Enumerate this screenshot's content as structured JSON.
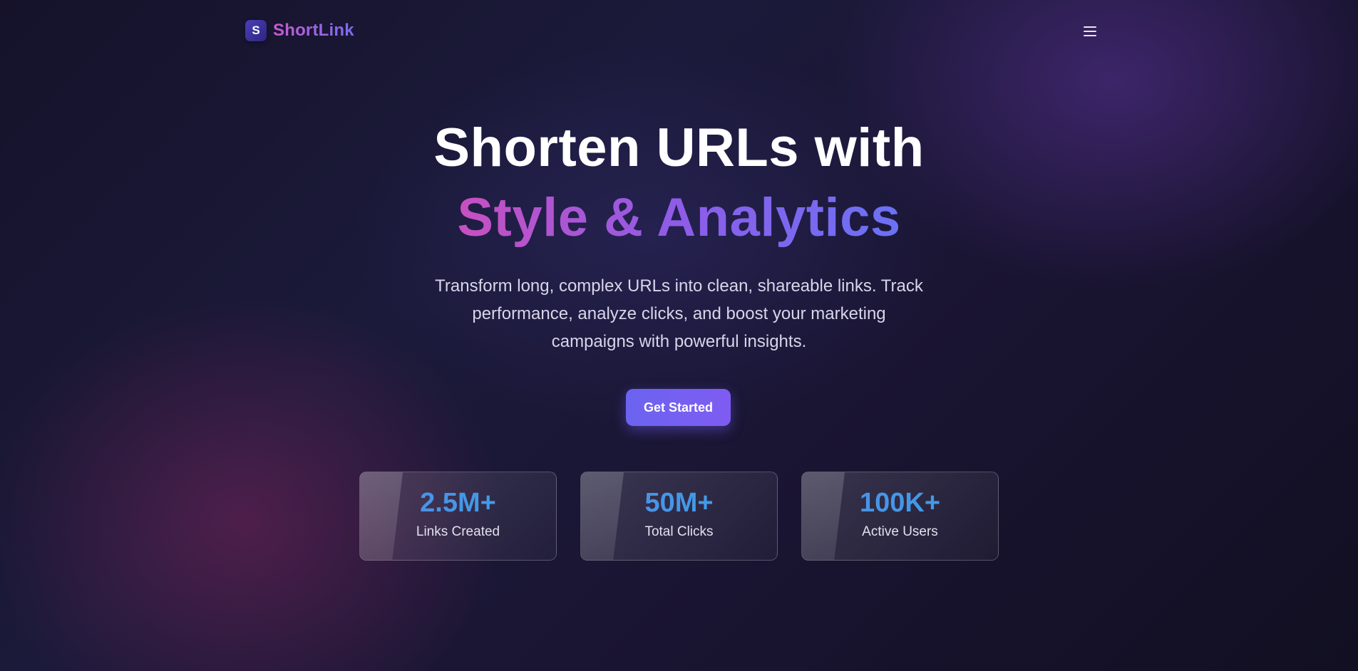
{
  "brand": {
    "logo_letter": "S",
    "name": "ShortLink"
  },
  "header": {
    "menu_icon": "hamburger-menu-icon"
  },
  "hero": {
    "title_line1": "Shorten URLs with",
    "title_line2": "Style & Analytics",
    "description": "Transform long, complex URLs into clean, shareable links. Track performance, analyze clicks, and boost your marketing campaigns with powerful insights.",
    "cta_label": "Get Started"
  },
  "stats": [
    {
      "value": "2.5M+",
      "label": "Links Created"
    },
    {
      "value": "50M+",
      "label": "Total Clicks"
    },
    {
      "value": "100K+",
      "label": "Active Users"
    }
  ],
  "colors": {
    "accent_start": "#c850c0",
    "accent_end": "#6a72f5",
    "cta": "#7360f1",
    "stat_value": "#4796e6",
    "background": "#1a1733"
  }
}
